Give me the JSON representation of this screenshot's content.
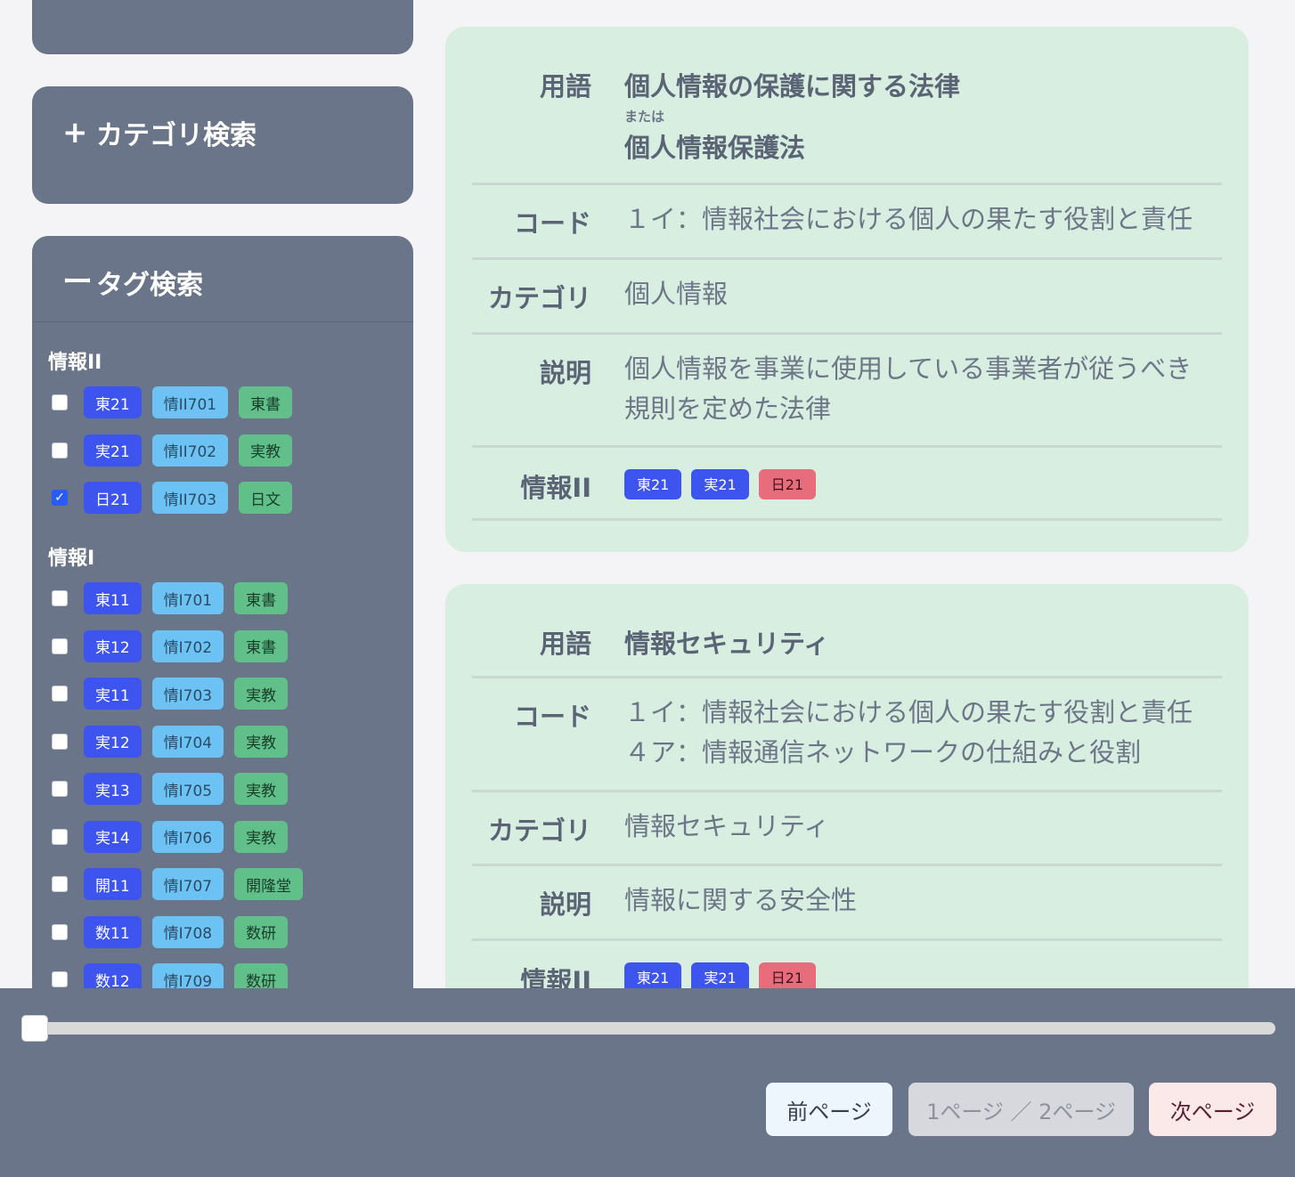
{
  "sidebar": {
    "category_search": {
      "sign": "+",
      "title": "カテゴリ検索"
    },
    "tag_search": {
      "sign": "ー",
      "title": "タグ検索",
      "groups": [
        {
          "title": "情報II",
          "rows": [
            {
              "checked": false,
              "school": "東21",
              "code": "情II701",
              "publisher": "東書"
            },
            {
              "checked": false,
              "school": "実21",
              "code": "情II702",
              "publisher": "実教"
            },
            {
              "checked": true,
              "school": "日21",
              "code": "情II703",
              "publisher": "日文"
            }
          ]
        },
        {
          "title": "情報I",
          "rows": [
            {
              "checked": false,
              "school": "東11",
              "code": "情I701",
              "publisher": "東書"
            },
            {
              "checked": false,
              "school": "東12",
              "code": "情I702",
              "publisher": "東書"
            },
            {
              "checked": false,
              "school": "実11",
              "code": "情I703",
              "publisher": "実教"
            },
            {
              "checked": false,
              "school": "実12",
              "code": "情I704",
              "publisher": "実教"
            },
            {
              "checked": false,
              "school": "実13",
              "code": "情I705",
              "publisher": "実教"
            },
            {
              "checked": false,
              "school": "実14",
              "code": "情I706",
              "publisher": "実教"
            },
            {
              "checked": false,
              "school": "開11",
              "code": "情I707",
              "publisher": "開隆堂"
            },
            {
              "checked": false,
              "school": "数11",
              "code": "情I708",
              "publisher": "数研"
            },
            {
              "checked": false,
              "school": "数12",
              "code": "情I709",
              "publisher": "数研"
            }
          ]
        }
      ]
    }
  },
  "cards": [
    {
      "term_label": "用語",
      "term": "個人情報の保護に関する法律",
      "or_label": "または",
      "term_alt": "個人情報保護法",
      "code_label": "コード",
      "codes": [
        "１イ：情報社会における個人の果たす役割と責任"
      ],
      "category_label": "カテゴリ",
      "category": "個人情報",
      "desc_label": "説明",
      "desc_lines": [
        "個人情報を事業に使用している事業者が従うべき",
        "規則を定めた法律"
      ],
      "tags_label": "情報II",
      "tags": [
        "東21",
        "実21",
        "日21"
      ]
    },
    {
      "term_label": "用語",
      "term": "情報セキュリティ",
      "code_label": "コード",
      "codes": [
        "１イ：情報社会における個人の果たす役割と責任",
        "４ア：情報通信ネットワークの仕組みと役割"
      ],
      "category_label": "カテゴリ",
      "category": "情報セキュリティ",
      "desc_label": "説明",
      "desc_lines": [
        "情報に関する安全性"
      ],
      "tags_label": "情報II",
      "tags": [
        "東21",
        "実21",
        "日21"
      ]
    }
  ],
  "pager": {
    "prev": "前ページ",
    "status": "1ページ ／ 2ページ",
    "next": "次ページ",
    "slider_value": 0
  },
  "colors": {
    "school_chip": "#3e54ee",
    "code_chip": "#6cc3f3",
    "publisher_chip": "#61bf8a",
    "highlight_chip": "#e86d7c"
  }
}
